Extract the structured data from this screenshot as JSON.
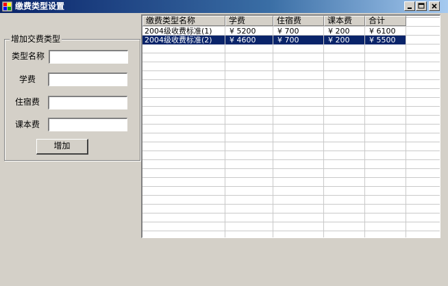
{
  "window": {
    "title": "缴费类型设置"
  },
  "form": {
    "group_title": "增加交费类型",
    "fields": [
      {
        "label": "类型名称",
        "value": "",
        "placeholder": ""
      },
      {
        "label": "学费",
        "value": "",
        "placeholder": ""
      },
      {
        "label": "住宿费",
        "value": "",
        "placeholder": ""
      },
      {
        "label": "课本费",
        "value": "",
        "placeholder": ""
      }
    ],
    "add_button": "增加"
  },
  "grid": {
    "columns": [
      "缴费类型名称",
      "学费",
      "住宿费",
      "课本费",
      "合计"
    ],
    "rows": [
      {
        "cells": [
          "2004级收费标准(1)",
          "¥ 5200",
          "¥ 700",
          "¥ 200",
          "¥ 6100"
        ],
        "selected": false
      },
      {
        "cells": [
          "2004级收费标准(2)",
          "¥ 4600",
          "¥ 700",
          "¥ 200",
          "¥ 5500"
        ],
        "selected": true
      }
    ]
  },
  "colors": {
    "titlebar_start": "#0a246a",
    "selection": "#0a246a",
    "window_bg": "#d4d0c8"
  },
  "icons": {
    "app": "app-icon",
    "minimize": "minimize-icon",
    "maximize": "maximize-icon",
    "close": "close-icon"
  }
}
